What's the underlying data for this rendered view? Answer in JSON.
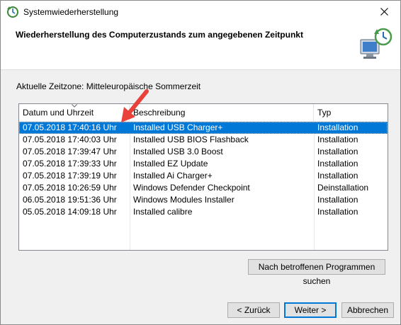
{
  "window": {
    "title": "Systemwiederherstellung",
    "close_glyph": "✕"
  },
  "header": {
    "title": "Wiederherstellung des Computerzustands zum angegebenen Zeitpunkt"
  },
  "timezone_label": "Aktuelle Zeitzone: Mitteleuropäische Sommerzeit",
  "table": {
    "columns": [
      "Datum und Uhrzeit",
      "Beschreibung",
      "Typ"
    ],
    "rows": [
      {
        "date": "07.05.2018 17:40:16 Uhr",
        "description": "Installed USB Charger+",
        "type": "Installation",
        "selected": true
      },
      {
        "date": "07.05.2018 17:40:03 Uhr",
        "description": "Installed USB BIOS Flashback",
        "type": "Installation",
        "selected": false
      },
      {
        "date": "07.05.2018 17:39:47 Uhr",
        "description": "Installed USB 3.0 Boost",
        "type": "Installation",
        "selected": false
      },
      {
        "date": "07.05.2018 17:39:33 Uhr",
        "description": "Installed EZ Update",
        "type": "Installation",
        "selected": false
      },
      {
        "date": "07.05.2018 17:39:19 Uhr",
        "description": "Installed Ai Charger+",
        "type": "Installation",
        "selected": false
      },
      {
        "date": "07.05.2018 10:26:59 Uhr",
        "description": "Windows Defender Checkpoint",
        "type": "Deinstallation",
        "selected": false
      },
      {
        "date": "06.05.2018 19:51:36 Uhr",
        "description": "Windows Modules Installer",
        "type": "Installation",
        "selected": false
      },
      {
        "date": "05.05.2018 14:09:18 Uhr",
        "description": "Installed calibre",
        "type": "Installation",
        "selected": false
      }
    ]
  },
  "buttons": {
    "scan": "Nach betroffenen Programmen suchen",
    "back": "< Zurück",
    "next": "Weiter >",
    "cancel": "Abbrechen"
  },
  "colors": {
    "selection": "#0078d7",
    "annotation_arrow": "#e8423a"
  },
  "icons": {
    "title_icon": "system-restore-icon",
    "header_icon": "system-restore-computer-icon",
    "sort": "sort-descending-icon"
  }
}
